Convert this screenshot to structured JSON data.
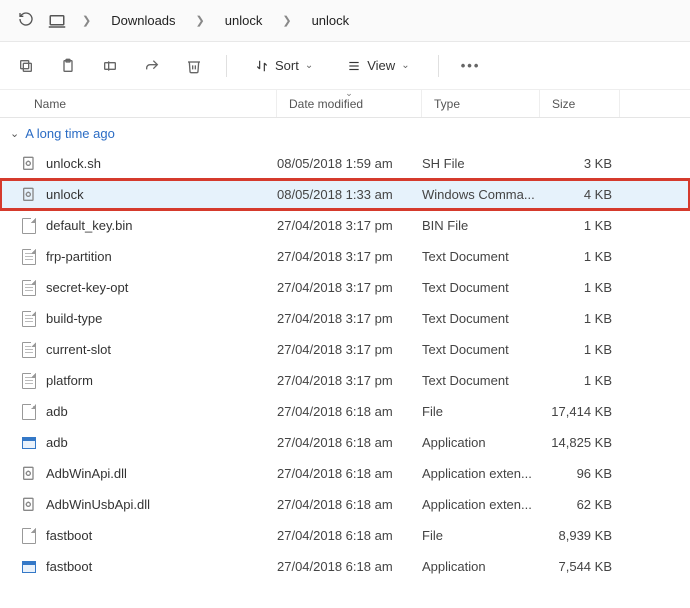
{
  "breadcrumb": {
    "items": [
      "Downloads",
      "unlock",
      "unlock"
    ]
  },
  "toolbar": {
    "sort_label": "Sort",
    "view_label": "View"
  },
  "headers": {
    "name": "Name",
    "date": "Date modified",
    "type": "Type",
    "size": "Size"
  },
  "group": {
    "label": "A long time ago"
  },
  "files": [
    {
      "name": "unlock.sh",
      "date": "08/05/2018 1:59 am",
      "type": "SH File",
      "size": "3 KB",
      "icon": "gear"
    },
    {
      "name": "unlock",
      "date": "08/05/2018 1:33 am",
      "type": "Windows Comma...",
      "size": "4 KB",
      "icon": "gear",
      "highlight": true
    },
    {
      "name": "default_key.bin",
      "date": "27/04/2018 3:17 pm",
      "type": "BIN File",
      "size": "1 KB",
      "icon": "page"
    },
    {
      "name": "frp-partition",
      "date": "27/04/2018 3:17 pm",
      "type": "Text Document",
      "size": "1 KB",
      "icon": "text"
    },
    {
      "name": "secret-key-opt",
      "date": "27/04/2018 3:17 pm",
      "type": "Text Document",
      "size": "1 KB",
      "icon": "text"
    },
    {
      "name": "build-type",
      "date": "27/04/2018 3:17 pm",
      "type": "Text Document",
      "size": "1 KB",
      "icon": "text"
    },
    {
      "name": "current-slot",
      "date": "27/04/2018 3:17 pm",
      "type": "Text Document",
      "size": "1 KB",
      "icon": "text"
    },
    {
      "name": "platform",
      "date": "27/04/2018 3:17 pm",
      "type": "Text Document",
      "size": "1 KB",
      "icon": "text"
    },
    {
      "name": "adb",
      "date": "27/04/2018 6:18 am",
      "type": "File",
      "size": "17,414 KB",
      "icon": "page"
    },
    {
      "name": "adb",
      "date": "27/04/2018 6:18 am",
      "type": "Application",
      "size": "14,825 KB",
      "icon": "app"
    },
    {
      "name": "AdbWinApi.dll",
      "date": "27/04/2018 6:18 am",
      "type": "Application exten...",
      "size": "96 KB",
      "icon": "gear"
    },
    {
      "name": "AdbWinUsbApi.dll",
      "date": "27/04/2018 6:18 am",
      "type": "Application exten...",
      "size": "62 KB",
      "icon": "gear"
    },
    {
      "name": "fastboot",
      "date": "27/04/2018 6:18 am",
      "type": "File",
      "size": "8,939 KB",
      "icon": "page"
    },
    {
      "name": "fastboot",
      "date": "27/04/2018 6:18 am",
      "type": "Application",
      "size": "7,544 KB",
      "icon": "app"
    }
  ]
}
